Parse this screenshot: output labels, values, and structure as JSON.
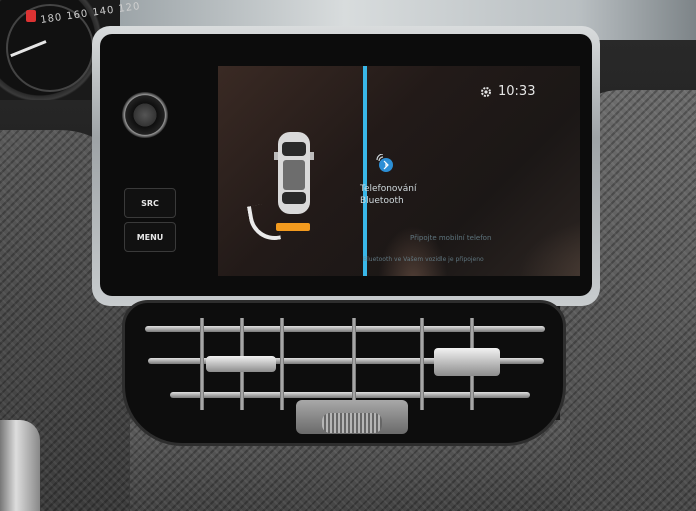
{
  "screen": {
    "clock": "10:33",
    "bluetooth_line1": "Telefonování",
    "bluetooth_line2": "Bluetooth",
    "bluetooth_hint": "Připojte mobilní telefon",
    "bluetooth_footer": "Bluetooth ve Vašem vozidle je připojeno"
  },
  "hardware": {
    "src_label": "SRC",
    "menu_label": "MENU"
  },
  "cluster": {
    "scale_text": "180 160 140 120"
  },
  "colors": {
    "divider": "#39b7e8",
    "sensor": "#f39a1e"
  }
}
